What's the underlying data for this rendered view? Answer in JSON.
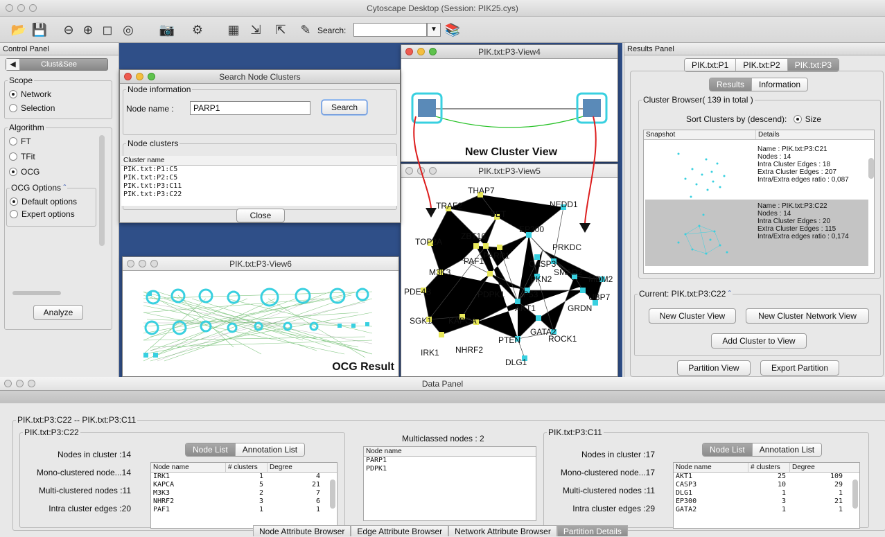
{
  "app": {
    "title": "Cytoscape Desktop (Session: PIK25.cys)",
    "search_label": "Search:",
    "search_value": ""
  },
  "control_panel": {
    "title": "Control Panel",
    "tab": "Clust&See",
    "scope_label": "Scope",
    "scope_options": [
      "Network",
      "Selection"
    ],
    "algorithm_label": "Algorithm",
    "algorithm_options": [
      "FT",
      "TFit",
      "OCG"
    ],
    "ocg_options_label": "OCG Options",
    "ocg_options": [
      "Default options",
      "Expert options"
    ],
    "analyze_button": "Analyze"
  },
  "search_dialog": {
    "title": "Search Node Clusters",
    "node_info_label": "Node information",
    "node_name_label": "Node name :",
    "node_name_value": "PARP1",
    "search_button": "Search",
    "clusters_label": "Node clusters",
    "column": "Cluster name",
    "rows": [
      "PIK.txt:P1:C5",
      "PIK.txt:P2:C5",
      "PIK.txt:P3:C11",
      "PIK.txt:P3:C22"
    ],
    "close_button": "Close"
  },
  "view4": {
    "title": "PIK.txt:P3-View4",
    "caption": "New Cluster View"
  },
  "view5": {
    "title": "PIK.txt:P3-View5",
    "nodes": [
      "THAP7",
      "TRAF2",
      "SET",
      "NEDD1",
      "ZBT16",
      "EP300",
      "TOP2A",
      "PARP1",
      "PAF1",
      "PRKDC",
      "CASP3",
      "M3K3",
      "SMAD2",
      "MDM2",
      "PDE4B",
      "PKN2",
      "PDPK1",
      "P53",
      "UBP7",
      "AKT1",
      "GRDN",
      "SGK1",
      "KAPCA",
      "GATA2",
      "PTEN",
      "ROCK1",
      "IRK1",
      "NHRF2",
      "DLG1"
    ]
  },
  "view6": {
    "title": "PIK.txt:P3-View6",
    "caption": "OCG Result"
  },
  "results_panel": {
    "title": "Results Panel",
    "tabs": [
      "PIK.txt:P1",
      "PIK.txt:P2",
      "PIK.txt:P3"
    ],
    "subtabs": [
      "Results",
      "Information"
    ],
    "browser_label": "Cluster Browser( 139 in total )",
    "sort_label": "Sort Clusters by (descend):",
    "sort_option": "Size",
    "col_snapshot": "Snapshot",
    "col_details": "Details",
    "clusters": [
      {
        "lines": [
          "Name : PIK.txt:P3:C21",
          "Nodes : 14",
          "Intra Cluster Edges : 18",
          "Extra Cluster Edges : 207",
          "Intra/Extra edges ratio : 0,087"
        ]
      },
      {
        "lines": [
          "Name : PIK.txt:P3:C22",
          "Nodes : 14",
          "Intra Cluster Edges : 20",
          "Extra Cluster Edges : 115",
          "Intra/Extra edges ratio : 0,174"
        ]
      }
    ],
    "current_label": "Current: PIK.txt:P3:C22",
    "buttons": [
      "New Cluster View",
      "New Cluster Network View",
      "Add Cluster to View",
      "Partition View",
      "Export Partition"
    ]
  },
  "data_panel": {
    "title": "Data Panel",
    "compare_label": "PIK.txt:P3:C22 -- PIK.txt:P3:C11",
    "left": {
      "label": "PIK.txt:P3:C22",
      "stats": [
        "Nodes in cluster :14",
        "Mono-clustered node...14",
        "Multi-clustered nodes :11",
        "Intra cluster edges :20"
      ],
      "tabs": [
        "Node List",
        "Annotation List"
      ],
      "columns": [
        "Node name",
        "# clusters",
        "Degree"
      ],
      "rows": [
        [
          "IRK1",
          "1",
          "4"
        ],
        [
          "KAPCA",
          "5",
          "21"
        ],
        [
          "M3K3",
          "2",
          "7"
        ],
        [
          "NHRF2",
          "3",
          "6"
        ],
        [
          "PAF1",
          "1",
          "1"
        ]
      ]
    },
    "middle": {
      "label": "Multiclassed nodes : 2",
      "column": "Node name",
      "rows": [
        "PARP1",
        "PDPK1"
      ]
    },
    "right": {
      "label": "PIK.txt:P3:C11",
      "stats": [
        "Nodes in cluster :17",
        "Mono-clustered node...17",
        "Multi-clustered nodes :11",
        "Intra cluster edges :29"
      ],
      "tabs": [
        "Node List",
        "Annotation List"
      ],
      "columns": [
        "Node name",
        "# clusters",
        "Degree"
      ],
      "rows": [
        [
          "AKT1",
          "25",
          "109"
        ],
        [
          "CASP3",
          "10",
          "29"
        ],
        [
          "DLG1",
          "1",
          "1"
        ],
        [
          "EP300",
          "3",
          "21"
        ],
        [
          "GATA2",
          "1",
          "1"
        ]
      ]
    },
    "bottom_tabs": [
      "Node Attribute Browser",
      "Edge Attribute Browser",
      "Network Attribute Browser",
      "Partition Details"
    ]
  },
  "colors": {
    "desktop_blue": "#2f4f88",
    "node_cyan": "#38d0e0",
    "node_yellow": "#e8e85a",
    "arrow_red": "#dd1e1e",
    "edge_green": "#22a022"
  }
}
